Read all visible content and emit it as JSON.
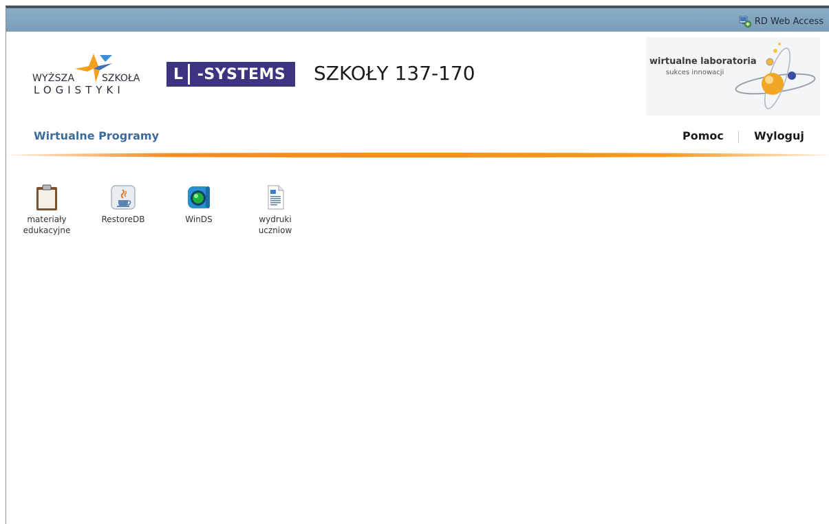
{
  "rd_bar": {
    "label": "RD Web Access"
  },
  "header": {
    "wsl_logo": {
      "line1_left": "WYŻSZA",
      "line1_right": "SZKOŁA",
      "line2": "LOGISTYKI"
    },
    "lsystems_logo": {
      "letter": "L",
      "text": "-SYSTEMS"
    },
    "title": "SZKOŁY 137-170",
    "wl_logo": {
      "title": "wirtualne laboratoria",
      "subtitle": "sukces innowacji"
    }
  },
  "nav": {
    "section_title": "Wirtualne Programy",
    "help_label": "Pomoc",
    "logout_label": "Wyloguj"
  },
  "apps": [
    {
      "label_line1": "materiały",
      "label_line2": "edukacyjne",
      "icon": "clipboard-icon"
    },
    {
      "label_line1": "RestoreDB",
      "label_line2": "",
      "icon": "java-icon"
    },
    {
      "label_line1": "WinDS",
      "label_line2": "",
      "icon": "winds-icon"
    },
    {
      "label_line1": "wydruki",
      "label_line2": "uczniow",
      "icon": "document-icon"
    }
  ],
  "colors": {
    "rd_bar": "#7a9db9",
    "nav_title": "#3d6b9a",
    "accent_orange": "#f58a21",
    "lsystems_purple": "#3b3480"
  }
}
